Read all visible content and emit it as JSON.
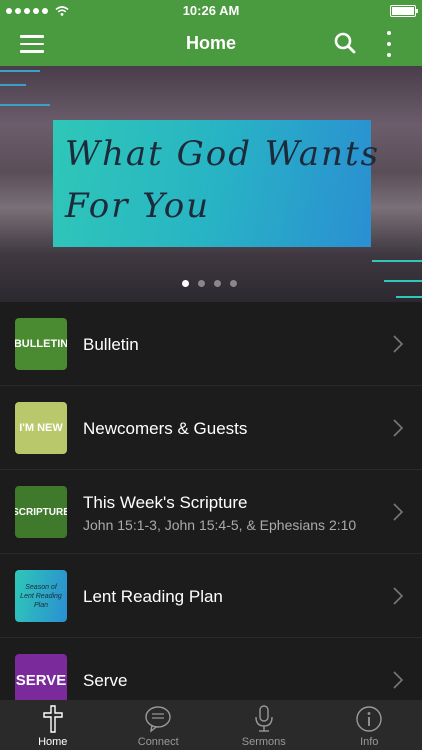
{
  "status_bar": {
    "time": "10:26 AM"
  },
  "nav": {
    "title": "Home"
  },
  "banner": {
    "line1": "What God Wants",
    "line2": "For You",
    "page_count": 4,
    "active_page": 0
  },
  "list": [
    {
      "thumb_text": "BULLETIN",
      "thumb_color": "#4a8a30",
      "title": "Bulletin",
      "subtitle": ""
    },
    {
      "thumb_text": "I'M NEW",
      "thumb_color": "#b8c86a",
      "title": "Newcomers & Guests",
      "subtitle": ""
    },
    {
      "thumb_text": "SCRIPTURE",
      "thumb_color": "#3f7a2c",
      "title": "This Week's Scripture",
      "subtitle": "John 15:1-3, John 15:4-5, & Ephesians 2:10"
    },
    {
      "thumb_text": "Season of Lent Reading Plan",
      "thumb_color": "#2aa8b8",
      "title": "Lent Reading Plan",
      "subtitle": ""
    },
    {
      "thumb_text": "SERVE",
      "thumb_color": "#7a2a9a",
      "title": "Serve",
      "subtitle": ""
    }
  ],
  "tabs": [
    {
      "label": "Home",
      "icon": "cross-icon",
      "active": true
    },
    {
      "label": "Connect",
      "icon": "chat-bubble-icon",
      "active": false
    },
    {
      "label": "Sermons",
      "icon": "microphone-icon",
      "active": false
    },
    {
      "label": "Info",
      "icon": "info-icon",
      "active": false
    }
  ],
  "colors": {
    "accent": "#4a9a3f",
    "background": "#1c1c1c",
    "tab_bar": "#2a2a2a"
  }
}
